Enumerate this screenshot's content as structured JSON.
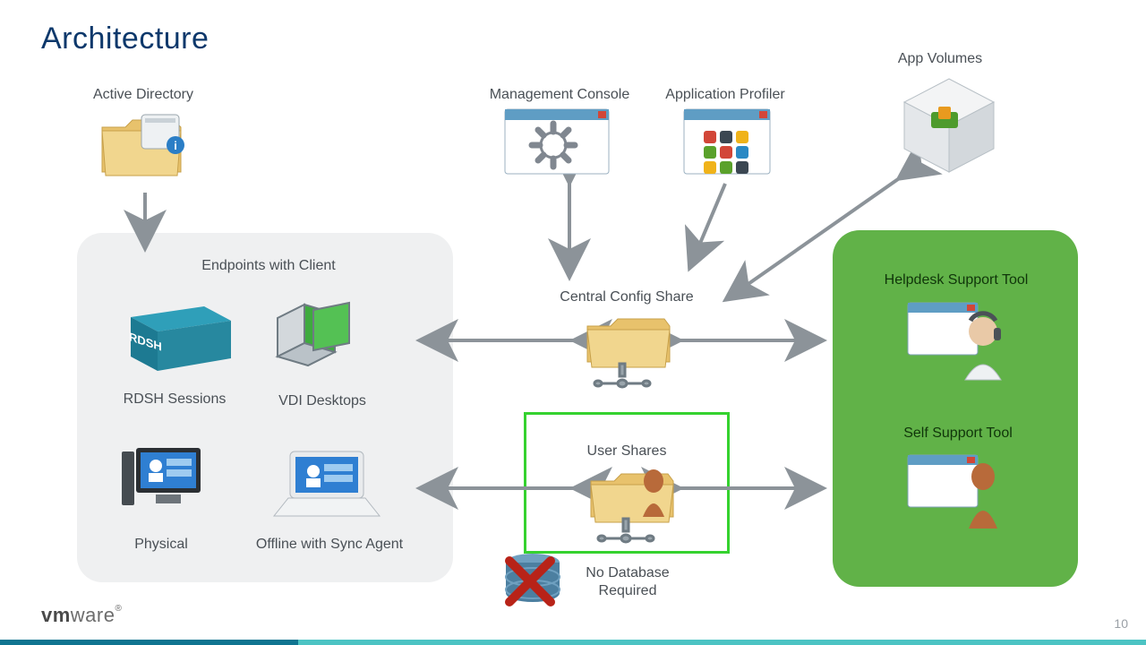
{
  "title": "Architecture",
  "nodes": {
    "active_directory": "Active Directory",
    "management_console": "Management Console",
    "application_profiler": "Application Profiler",
    "app_volumes": "App Volumes",
    "endpoints_header": "Endpoints with Client",
    "rdsh": "RDSH Sessions",
    "vdi": "VDI Desktops",
    "physical": "Physical",
    "offline": "Offline with Sync Agent",
    "central_config": "Central Config Share",
    "user_shares": "User Shares",
    "no_db": "No Database\nRequired",
    "helpdesk": "Helpdesk Support Tool",
    "selfsupport": "Self Support Tool"
  },
  "green_text_color": "#10350a",
  "logo_pre": "vm",
  "logo_post": "ware",
  "page_number": "10"
}
